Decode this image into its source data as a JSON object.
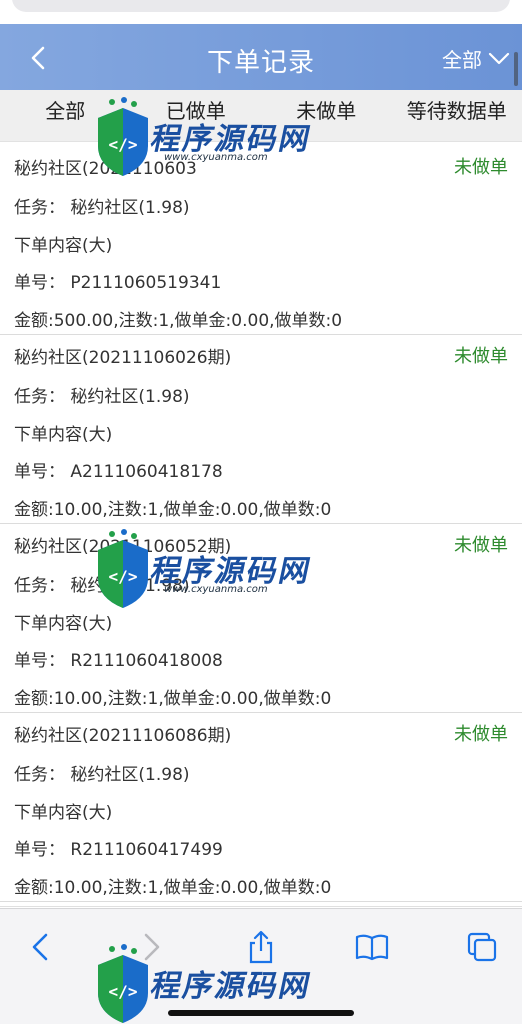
{
  "header": {
    "title": "下单记录",
    "filter_label": "全部",
    "colors": {
      "bar": "#6b93d6",
      "text": "#ffffff"
    }
  },
  "tabs": [
    "全部",
    "已做单",
    "未做单",
    "等待数据单"
  ],
  "records": [
    {
      "name": "秘约社区(2021110603",
      "status": "未做单",
      "task": "任务：  秘约社区(1.98)",
      "content": "下单内容(大)",
      "order_no": "单号：  P2111060519341",
      "summary": "金额:500.00,注数:1,做单金:0.00,做单数:0"
    },
    {
      "name": "秘约社区(20211106026期)",
      "status": "未做单",
      "task": "任务：  秘约社区(1.98)",
      "content": "下单内容(大)",
      "order_no": "单号：  A2111060418178",
      "summary": "金额:10.00,注数:1,做单金:0.00,做单数:0"
    },
    {
      "name": "秘约社区(20211106052期)",
      "status": "未做单",
      "task": "任务：  秘约社区(1.98)",
      "content": "下单内容(大)",
      "order_no": "单号：  R2111060418008",
      "summary": "金额:10.00,注数:1,做单金:0.00,做单数:0"
    },
    {
      "name": "秘约社区(20211106086期)",
      "status": "未做单",
      "task": "任务：  秘约社区(1.98)",
      "content": "下单内容(大)",
      "order_no": "单号：  R2111060417499",
      "summary": "金额:10.00,注数:1,做单金:0.00,做单数:0"
    }
  ],
  "status_color": "#2e8b2e",
  "watermark": {
    "name": "程序源码网",
    "url": "www.cxyuanma.com"
  },
  "browser_toolbar": {
    "icons": [
      "back-icon",
      "forward-icon",
      "share-icon",
      "bookmarks-icon",
      "tabs-icon"
    ]
  }
}
